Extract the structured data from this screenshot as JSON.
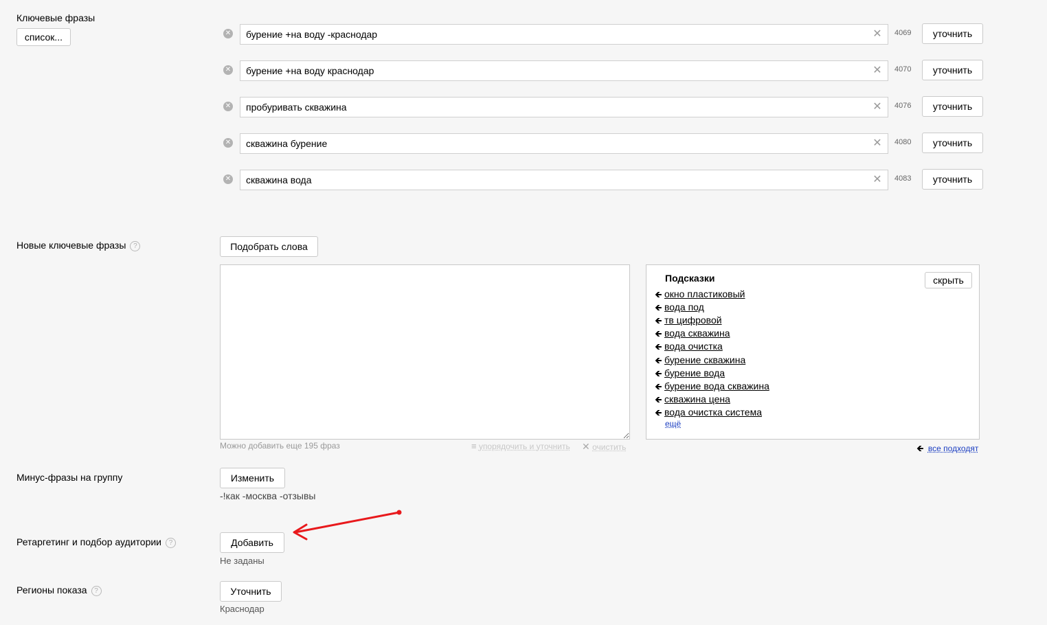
{
  "keywords_section": {
    "label": "Ключевые фразы",
    "list_button": "список...",
    "refine_label": "уточнить",
    "items": [
      {
        "phrase": "бурение +на воду -краснодар",
        "count": "4069"
      },
      {
        "phrase": "бурение +на воду краснодар",
        "count": "4070"
      },
      {
        "phrase": "пробуривать скважина",
        "count": "4076"
      },
      {
        "phrase": "скважина бурение",
        "count": "4080"
      },
      {
        "phrase": "скважина вода",
        "count": "4083"
      }
    ]
  },
  "new_keywords": {
    "label": "Новые ключевые фразы",
    "pick_button": "Подобрать слова",
    "remaining": "Можно добавить еще 195 фраз",
    "sort_link": "упорядочить и уточнить",
    "clear_link": "очистить"
  },
  "hints": {
    "title": "Подсказки",
    "hide_button": "скрыть",
    "items": [
      "окно пластиковый",
      "вода под",
      "тв цифровой",
      "вода скважина",
      "вода очистка",
      "бурение скважина",
      "бурение вода",
      "бурение вода скважина",
      "скважина цена",
      "вода очистка система"
    ],
    "more_link": "ещё",
    "all_fit_link": "все подходят"
  },
  "minus_phrases": {
    "label": "Минус-фразы на группу",
    "change_button": "Изменить",
    "value": "-!как -москва -отзывы"
  },
  "retargeting": {
    "label": "Ретаргетинг и подбор аудитории",
    "add_button": "Добавить",
    "value": "Не заданы"
  },
  "regions": {
    "label": "Регионы показа",
    "refine_button": "Уточнить",
    "value": "Краснодар"
  },
  "colors": {
    "annotation_arrow": "#e8191c",
    "link_blue": "#1a3dc1"
  }
}
